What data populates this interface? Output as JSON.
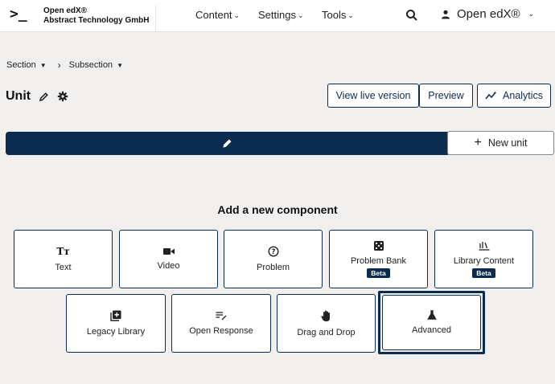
{
  "header": {
    "logo_mark": ">_",
    "logo_line1": "Open edX®",
    "logo_line2": "Abstract Technology GmbH",
    "nav": [
      "Content",
      "Settings",
      "Tools"
    ],
    "user_label": "Open edX®"
  },
  "breadcrumb": {
    "section": "Section",
    "subsection": "Subsection"
  },
  "unit": {
    "title": "Unit"
  },
  "actions": {
    "view_live": "View live version",
    "preview": "Preview",
    "analytics": "Analytics"
  },
  "new_unit_label": "New unit",
  "add_component": {
    "title": "Add a new component",
    "components": [
      {
        "label": "Text",
        "icon": "text-icon"
      },
      {
        "label": "Video",
        "icon": "video-icon"
      },
      {
        "label": "Problem",
        "icon": "problem-icon"
      },
      {
        "label": "Problem Bank",
        "icon": "dice-icon",
        "badge": "Beta"
      },
      {
        "label": "Library Content",
        "icon": "library-icon",
        "badge": "Beta"
      },
      {
        "label": "Legacy Library",
        "icon": "library-add-icon"
      },
      {
        "label": "Open Response",
        "icon": "open-response-icon"
      },
      {
        "label": "Drag and Drop",
        "icon": "hand-icon"
      },
      {
        "label": "Advanced",
        "icon": "flask-icon"
      }
    ]
  },
  "colors": {
    "primary": "#0b2b4f",
    "background": "#f2f0ef"
  }
}
